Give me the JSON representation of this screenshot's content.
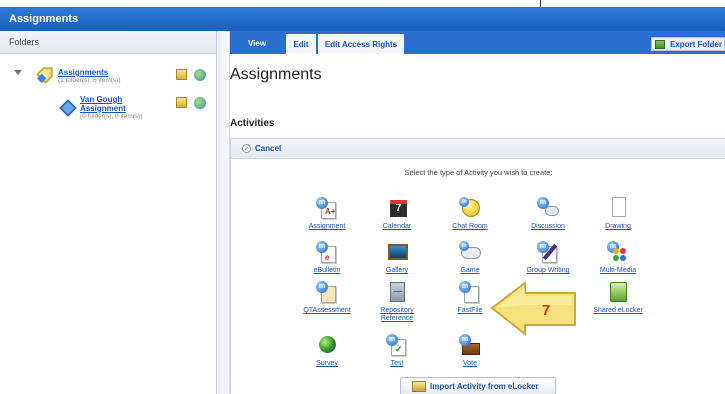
{
  "window": {
    "title": "Assignments"
  },
  "folders_panel": {
    "header": "Folders",
    "tree": [
      {
        "name": "Assignments",
        "detail": "(1 folder(s), 6 item(s))"
      },
      {
        "name_line1": "Van Gough",
        "name_line2": "Assignment",
        "detail": "(0 folder(s), 0 item(s))"
      }
    ]
  },
  "tabs": [
    {
      "label": "View",
      "active": true
    },
    {
      "label": "Edit",
      "active": false
    },
    {
      "label": "Edit Access Rights",
      "active": false
    }
  ],
  "toolbar": {
    "export_label": "Export Folder"
  },
  "main": {
    "title": "Assignments",
    "section_label": "Activities",
    "cancel_label": "Cancel",
    "instruction": "Select the type of Activity you wish to create:",
    "activities": [
      {
        "label": "Assignment",
        "icon": "assignment-icon"
      },
      {
        "label": "Calendar",
        "icon": "calendar-icon"
      },
      {
        "label": "Chat Room",
        "icon": "chat-room-icon"
      },
      {
        "label": "Discussion",
        "icon": "discussion-icon"
      },
      {
        "label": "Drawing",
        "icon": "drawing-icon"
      },
      {
        "label": "eBulletin",
        "icon": "ebulletin-icon"
      },
      {
        "label": "Gallery",
        "icon": "gallery-icon"
      },
      {
        "label": "Game",
        "icon": "game-icon"
      },
      {
        "label": "Group Writing",
        "icon": "group-writing-icon"
      },
      {
        "label": "Multi-Media",
        "icon": "multimedia-icon"
      },
      {
        "label": "QTAssessment",
        "icon": "qtassessment-icon"
      },
      {
        "label_line1": "Repository",
        "label_line2": "Reference",
        "icon": "repository-icon"
      },
      {
        "label": "FastFile",
        "icon": "fastfile-icon"
      },
      {
        "label": "ader",
        "icon": "reader-icon"
      },
      {
        "label": "Shared eLocker",
        "icon": "shared-elocker-icon"
      },
      {
        "label": "Survey",
        "icon": "survey-icon"
      },
      {
        "label": "Test",
        "icon": "test-icon"
      },
      {
        "label": "Vote",
        "icon": "vote-icon"
      }
    ],
    "import_label": "Import Activity from eLocker"
  },
  "callout": {
    "number": "7"
  },
  "colors": {
    "brand_blue": "#1a5fbf",
    "link_blue": "#1a52c6",
    "callout_yellow": "#f6e27a"
  }
}
